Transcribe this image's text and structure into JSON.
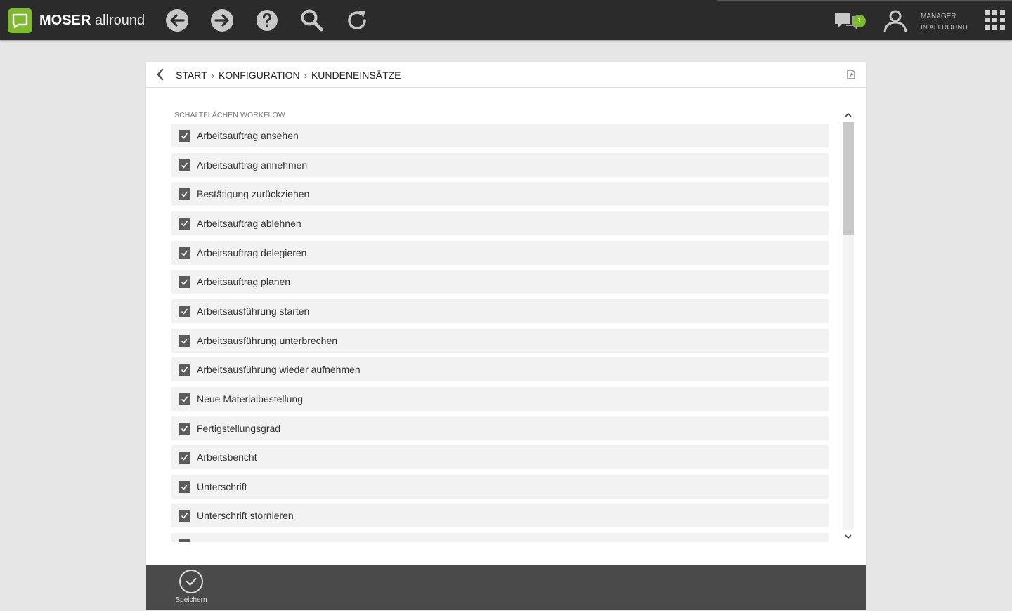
{
  "header": {
    "brand_bold": "MOSER",
    "brand_light": "allround",
    "chat_count": "1",
    "user_line1": "MANAGER",
    "user_line2": "IN ALLROUND"
  },
  "icons": {
    "logo": "chat-bubble-logo",
    "back": "arrow-left-icon",
    "forward": "arrow-right-icon",
    "help": "question-icon",
    "search": "search-icon",
    "refresh": "refresh-icon",
    "chat": "chat-icon",
    "user": "user-icon",
    "apps": "apps-grid-icon"
  },
  "breadcrumb": {
    "items": [
      "START",
      "KONFIGURATION",
      "KUNDENEINSÄTZE"
    ],
    "separator": "›"
  },
  "section": {
    "label": "SCHALTFLÄCHEN WORKFLOW",
    "items": [
      {
        "label": "Arbeitsauftrag ansehen",
        "checked": true
      },
      {
        "label": "Arbeitsauftrag annehmen",
        "checked": true
      },
      {
        "label": "Bestätigung zurückziehen",
        "checked": true
      },
      {
        "label": "Arbeitsauftrag ablehnen",
        "checked": true
      },
      {
        "label": "Arbeitsauftrag delegieren",
        "checked": true
      },
      {
        "label": "Arbeitsauftrag planen",
        "checked": true
      },
      {
        "label": "Arbeitsausführung starten",
        "checked": true
      },
      {
        "label": "Arbeitsausführung unterbrechen",
        "checked": true
      },
      {
        "label": "Arbeitsausführung wieder aufnehmen",
        "checked": true
      },
      {
        "label": "Neue Materialbestellung",
        "checked": true
      },
      {
        "label": "Fertigstellungsgrad",
        "checked": true
      },
      {
        "label": "Arbeitsbericht",
        "checked": true
      },
      {
        "label": "Unterschrift",
        "checked": true
      },
      {
        "label": "Unterschrift stornieren",
        "checked": true
      },
      {
        "label": "",
        "checked": true
      }
    ]
  },
  "footer": {
    "save_label": "Speichern"
  },
  "colors": {
    "topbar": "#2b2b2b",
    "accent": "#7dbb2c",
    "footer": "#4a4a4a",
    "row_bg": "#f2f2f2",
    "checkbox": "#5c5c5c"
  }
}
